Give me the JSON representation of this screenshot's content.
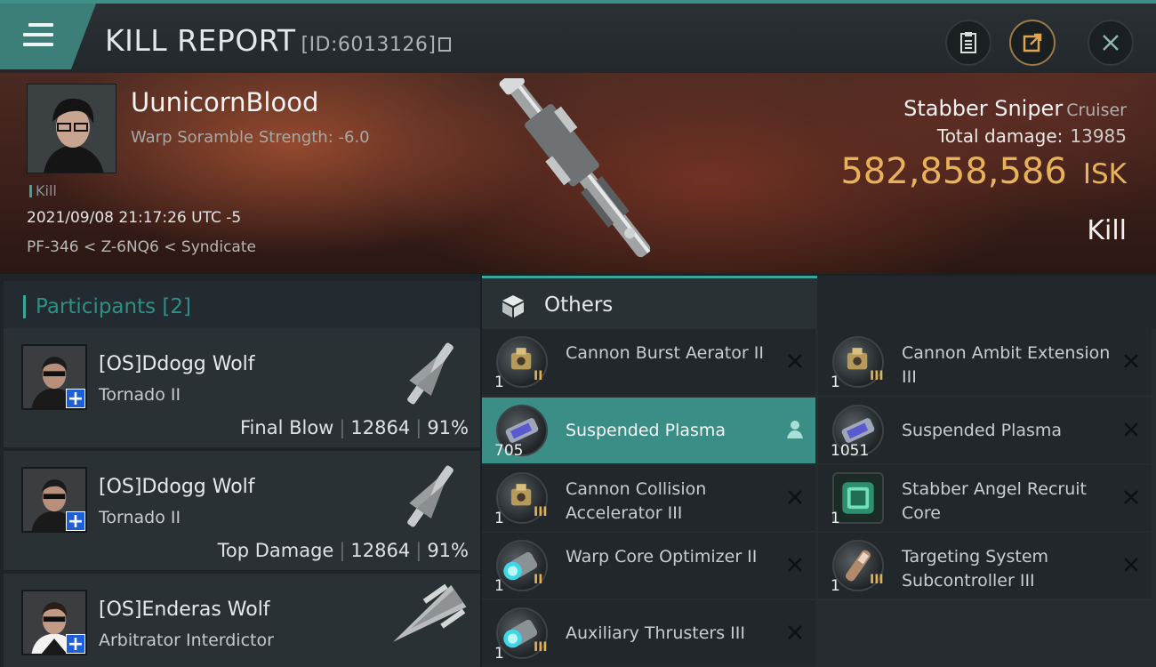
{
  "header": {
    "title": "KILL REPORT",
    "report_id": "[ID:6013126]",
    "icons": [
      "menu-icon",
      "copy-icon",
      "clipboard-icon",
      "share-icon",
      "close-icon"
    ]
  },
  "banner": {
    "victim_name": "UunicornBlood",
    "scramble_text": "Warp Soramble Strength: -6.0",
    "kill_tag": "Kill",
    "datetime": "2021/09/08 21:17:26 UTC -5",
    "location": "PF-346 < Z-6NQ6 < Syndicate",
    "ship_name": "Stabber Sniper",
    "ship_class": "Cruiser",
    "damage_label": "Total damage:",
    "damage_value": "13985",
    "isk_value": "582,858,586",
    "isk_unit": "ISK",
    "result": "Kill"
  },
  "participants": {
    "title": "Participants [2]",
    "rows": [
      {
        "name": "[OS]Ddogg Wolf",
        "ship": "Tornado II",
        "stat_label": "Final Blow",
        "damage": "12864",
        "percent": "91%"
      },
      {
        "name": "[OS]Ddogg Wolf",
        "ship": "Tornado II",
        "stat_label": "Top Damage",
        "damage": "12864",
        "percent": "91%"
      },
      {
        "name": "[OS]Enderas Wolf",
        "ship": "Arbitrator Interdictor"
      }
    ]
  },
  "others": {
    "title": "Others",
    "items": [
      {
        "name": "Cannon Burst Aerator II",
        "qty": "1",
        "meta": "II",
        "icon": "rig-icon",
        "action": "destroyed-icon"
      },
      {
        "name": "Cannon Ambit Extension III",
        "qty": "1",
        "meta": "III",
        "icon": "rig-icon",
        "action": "destroyed-icon"
      },
      {
        "name": "Suspended Plasma",
        "qty": "705",
        "meta": "",
        "icon": "plasma-canister-icon",
        "action": "dropped-icon"
      },
      {
        "name": "Suspended Plasma",
        "qty": "1051",
        "meta": "",
        "icon": "plasma-canister-icon",
        "action": "destroyed-icon"
      },
      {
        "name": "Cannon Collision Accelerator III",
        "qty": "1",
        "meta": "III",
        "icon": "rig-icon",
        "action": "destroyed-icon"
      },
      {
        "name": "Stabber Angel Recruit Core",
        "qty": "1",
        "meta": "",
        "icon": "core-icon",
        "action": "destroyed-icon"
      },
      {
        "name": "Warp Core Optimizer II",
        "qty": "1",
        "meta": "II",
        "icon": "thruster-icon",
        "action": "destroyed-icon"
      },
      {
        "name": "Targeting System Subcontroller III",
        "qty": "1",
        "meta": "III",
        "icon": "subcontroller-icon",
        "action": "destroyed-icon"
      },
      {
        "name": "Auxiliary Thrusters III",
        "qty": "1",
        "meta": "III",
        "icon": "thruster-icon",
        "action": "destroyed-icon"
      }
    ]
  },
  "colors": {
    "accent": "#3aa69a",
    "isk": "#e8b25b",
    "selected_row": "#3b8e86",
    "badge": "#1e5fd6"
  }
}
